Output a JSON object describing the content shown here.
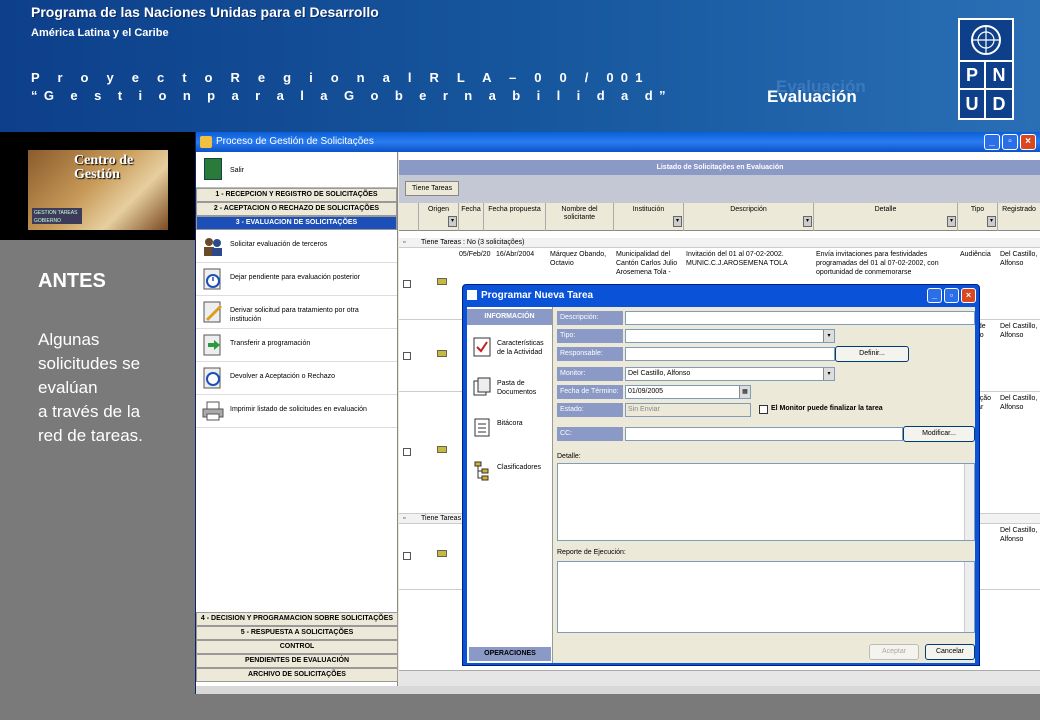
{
  "header": {
    "line1": "Programa de las  Naciones Unidas para el  Desarrollo",
    "line2": "América Latina y el Caribe",
    "line3": "P r o y e c t o   R e g i o n a l  R L A – 0 0 / 001",
    "line4": "“G e s t i o n  p a r a  l a  G o b e r n a b i l i d a d”",
    "title_ghost": "Evaluación",
    "title": "Evaluación",
    "logo_letters": [
      "P",
      "N",
      "U",
      "D"
    ]
  },
  "left": {
    "photo_caption": "Centro de Gestión",
    "photo_logo": "GESTION TAREAS GOBIERNO",
    "heading": "ANTES",
    "desc_lines": [
      "Algunas",
      "solicitudes se",
      "evalúan",
      "a través de  la",
      "red de tareas."
    ]
  },
  "app": {
    "window_title": "Proceso de Gestión de Solicitações",
    "exit_label": "Salir",
    "sections_top": [
      "1 - RECEPCION Y REGISTRO DE SOLICITAÇÕES",
      "2 - ACEPTACION O RECHAZO DE SOLICITAÇÕES",
      "3 - EVALUACION DE SOLICITAÇÕES"
    ],
    "actions": [
      "Solicitar evaluación de terceros",
      "Dejar pendiente para evaluación posterior",
      "Derivar solicitud para tratamiento por otra institución",
      "Transferir a programación",
      "Devolver a Aceptación o Rechazo",
      "Imprimir listado de solicitudes en evaluación"
    ],
    "sections_bottom": [
      "4 - DECISION Y PROGRAMACION SOBRE SOLICITAÇÕES",
      "5 - RESPUESTA A SOLICITAÇÕES",
      "CONTROL",
      "PENDIENTES DE EVALUACIÓN",
      "ARCHIVO DE SOLICITAÇÕES"
    ],
    "list_title": "Listado de Solicitações en Evaluación",
    "group_chip": "Tiene Tareas",
    "columns": [
      "Origen",
      "Fecha",
      "Fecha propuesta",
      "Nombre del solicitante",
      "Institución",
      "Descripción",
      "Detalle",
      "Tipo",
      "Registrado"
    ],
    "group1": "Tiene Tareas : No  (3 solicitações)",
    "group2": "Tiene Tareas",
    "rows": [
      {
        "fecha": "05/Feb/20",
        "propuesta": "16/Abr/2004",
        "nombre": "Márquez Obando, Octavio",
        "inst": "Municipalidad del Cantón Carlos Julio Arosemena Tola -",
        "desc": "Invitación del 01 al 07-02-2002. MUNIC.C.J.AROSEMENA TOLA",
        "detalle": "Envía invitaciones para festividades programadas del 01 al 07-02-2002, con oportunidad de conmemorarse",
        "tipo": "Audiência",
        "reg": "Del Castillo, Alfonso"
      },
      {
        "fecha": "",
        "propuesta": "",
        "nombre": "",
        "inst": "",
        "desc": "",
        "detalle": "",
        "tipo": "e de orio",
        "reg": "Del Castillo, Alfonso"
      },
      {
        "fecha": "",
        "propuesta": "",
        "nombre": "",
        "inst": "",
        "desc": "",
        "detalle": "",
        "tipo": "nação isar",
        "reg": "Del Castillo, Alfonso"
      },
      {
        "fecha": "",
        "propuesta": "",
        "nombre": "",
        "inst": "",
        "desc": "",
        "detalle": "",
        "tipo": "al",
        "reg": "Del Castillo, Alfonso"
      }
    ]
  },
  "dialog": {
    "title": "Programar Nueva Tarea",
    "nav_header": "INFORMACIÓN",
    "nav_items": [
      "Características de la Actividad",
      "Pasta de Documentos",
      "Bitácora",
      "Clasificadores"
    ],
    "nav_footer": "OPERACIONES",
    "labels": {
      "descripcion": "Descripción:",
      "tipo": "Tipo:",
      "responsable": "Responsable:",
      "monitor": "Monitor:",
      "fecha": "Fecha de Término:",
      "estado": "Estado:",
      "cc": "CC:",
      "detalle": "Detalle:",
      "reporte": "Reporte de Ejecución:"
    },
    "values": {
      "monitor": "Del Castillo, Alfonso",
      "fecha": "01/09/2005",
      "estado": "Sin Enviar"
    },
    "checkbox_label": "El Monitor puede finalizar la tarea",
    "buttons": {
      "definir": "Definir...",
      "modificar": "Modificar...",
      "aceptar": "Aceptar",
      "cancelar": "Cancelar"
    }
  }
}
